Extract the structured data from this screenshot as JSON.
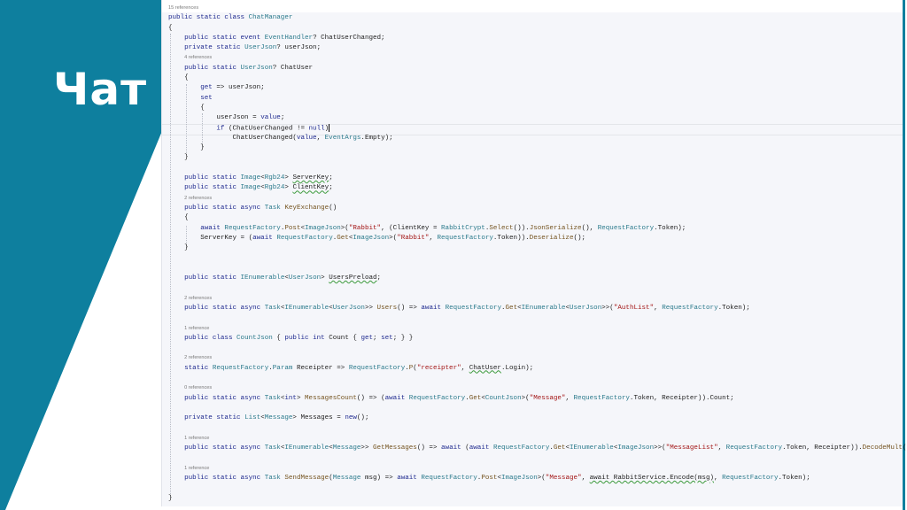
{
  "slide": {
    "title": "Чат",
    "accent": "#0e7f9e"
  },
  "code": {
    "lines": [
      {
        "i": 0,
        "r": "15 references"
      },
      {
        "i": 0,
        "t": [
          [
            "public static class ",
            "k"
          ],
          [
            "ChatManager",
            "t"
          ]
        ]
      },
      {
        "i": 0,
        "t": [
          [
            "{",
            "p"
          ]
        ]
      },
      {
        "i": 4,
        "t": [
          [
            "public static event ",
            "k"
          ],
          [
            "EventHandler",
            "t"
          ],
          [
            "? ChatUserChanged;",
            "p"
          ]
        ]
      },
      {
        "i": 4,
        "t": [
          [
            "private static ",
            "k"
          ],
          [
            "UserJson",
            "t"
          ],
          [
            "? userJson;",
            "p"
          ]
        ]
      },
      {
        "i": 4,
        "r": "4 references"
      },
      {
        "i": 4,
        "t": [
          [
            "public static ",
            "k"
          ],
          [
            "UserJson",
            "t"
          ],
          [
            "? ChatUser",
            "p"
          ]
        ]
      },
      {
        "i": 4,
        "t": [
          [
            "{",
            "p"
          ]
        ]
      },
      {
        "i": 8,
        "t": [
          [
            "get",
            "k"
          ],
          [
            " => userJson;",
            "p"
          ]
        ]
      },
      {
        "i": 8,
        "t": [
          [
            "set",
            "k"
          ]
        ]
      },
      {
        "i": 8,
        "t": [
          [
            "{",
            "p"
          ]
        ]
      },
      {
        "i": 12,
        "t": [
          [
            "userJson = ",
            "p"
          ],
          [
            "value",
            "k"
          ],
          [
            ";",
            "p"
          ]
        ]
      },
      {
        "i": 12,
        "t": [
          [
            "if",
            "k"
          ],
          [
            " (ChatUserChanged != ",
            "p"
          ],
          [
            "null",
            "k"
          ],
          [
            ")",
            "p"
          ]
        ],
        "caret": true
      },
      {
        "i": 16,
        "t": [
          [
            "ChatUserChanged(",
            "p"
          ],
          [
            "value",
            "k"
          ],
          [
            ", ",
            "p"
          ],
          [
            "EventArgs",
            "t"
          ],
          [
            ".Empty);",
            "p"
          ]
        ]
      },
      {
        "i": 8,
        "t": [
          [
            "}",
            "p"
          ]
        ]
      },
      {
        "i": 4,
        "t": [
          [
            "}",
            "p"
          ]
        ]
      },
      {
        "i": 0
      },
      {
        "i": 4,
        "t": [
          [
            "public static ",
            "k"
          ],
          [
            "Image",
            "t"
          ],
          [
            "<",
            "p"
          ],
          [
            "Rgb24",
            "t"
          ],
          [
            "> ",
            "p"
          ],
          [
            "ServerKey",
            "w"
          ],
          [
            ";",
            "p"
          ]
        ]
      },
      {
        "i": 4,
        "t": [
          [
            "public static ",
            "k"
          ],
          [
            "Image",
            "t"
          ],
          [
            "<",
            "p"
          ],
          [
            "Rgb24",
            "t"
          ],
          [
            "> ",
            "p"
          ],
          [
            "ClientKey",
            "w"
          ],
          [
            ";",
            "p"
          ]
        ]
      },
      {
        "i": 4,
        "r": "2 references"
      },
      {
        "i": 4,
        "t": [
          [
            "public static async ",
            "k"
          ],
          [
            "Task",
            "t"
          ],
          [
            " ",
            "p"
          ],
          [
            "KeyExchange",
            "m"
          ],
          [
            "()",
            "p"
          ]
        ]
      },
      {
        "i": 4,
        "t": [
          [
            "{",
            "p"
          ]
        ]
      },
      {
        "i": 8,
        "t": [
          [
            "await ",
            "k"
          ],
          [
            "RequestFactory",
            "t"
          ],
          [
            ".",
            "p"
          ],
          [
            "Post",
            "m"
          ],
          [
            "<",
            "p"
          ],
          [
            "ImageJson",
            "t"
          ],
          [
            ">(",
            "p"
          ],
          [
            "\"Rabbit\"",
            "s"
          ],
          [
            ", (ClientKey = ",
            "p"
          ],
          [
            "RabbitCrypt",
            "t"
          ],
          [
            ".",
            "p"
          ],
          [
            "Select",
            "m"
          ],
          [
            "()).",
            "p"
          ],
          [
            "JsonSerialize",
            "m"
          ],
          [
            "(), ",
            "p"
          ],
          [
            "RequestFactory",
            "t"
          ],
          [
            ".Token);",
            "p"
          ]
        ]
      },
      {
        "i": 8,
        "t": [
          [
            "ServerKey = (",
            "p"
          ],
          [
            "await ",
            "k"
          ],
          [
            "RequestFactory",
            "t"
          ],
          [
            ".",
            "p"
          ],
          [
            "Get",
            "m"
          ],
          [
            "<",
            "p"
          ],
          [
            "ImageJson",
            "t"
          ],
          [
            ">(",
            "p"
          ],
          [
            "\"Rabbit\"",
            "s"
          ],
          [
            ", ",
            "p"
          ],
          [
            "RequestFactory",
            "t"
          ],
          [
            ".Token)).",
            "p"
          ],
          [
            "Deserialize",
            "m"
          ],
          [
            "();",
            "p"
          ]
        ]
      },
      {
        "i": 4,
        "t": [
          [
            "}",
            "p"
          ]
        ]
      },
      {
        "i": 0
      },
      {
        "i": 0
      },
      {
        "i": 4,
        "t": [
          [
            "public static ",
            "k"
          ],
          [
            "IEnumerable",
            "t"
          ],
          [
            "<",
            "p"
          ],
          [
            "UserJson",
            "t"
          ],
          [
            "> ",
            "p"
          ],
          [
            "UsersPreload",
            "w"
          ],
          [
            ";",
            "p"
          ]
        ]
      },
      {
        "i": 0
      },
      {
        "i": 4,
        "r": "2 references"
      },
      {
        "i": 4,
        "t": [
          [
            "public static async ",
            "k"
          ],
          [
            "Task",
            "t"
          ],
          [
            "<",
            "p"
          ],
          [
            "IEnumerable",
            "t"
          ],
          [
            "<",
            "p"
          ],
          [
            "UserJson",
            "t"
          ],
          [
            ">> ",
            "p"
          ],
          [
            "Users",
            "m"
          ],
          [
            "() => ",
            "p"
          ],
          [
            "await ",
            "k"
          ],
          [
            "RequestFactory",
            "t"
          ],
          [
            ".",
            "p"
          ],
          [
            "Get",
            "m"
          ],
          [
            "<",
            "p"
          ],
          [
            "IEnumerable",
            "t"
          ],
          [
            "<",
            "p"
          ],
          [
            "UserJson",
            "t"
          ],
          [
            ">>(",
            "p"
          ],
          [
            "\"AuthList\"",
            "s"
          ],
          [
            ", ",
            "p"
          ],
          [
            "RequestFactory",
            "t"
          ],
          [
            ".Token);",
            "p"
          ]
        ]
      },
      {
        "i": 0
      },
      {
        "i": 4,
        "r": "1 reference"
      },
      {
        "i": 4,
        "t": [
          [
            "public class ",
            "k"
          ],
          [
            "CountJson",
            "t"
          ],
          [
            " { ",
            "p"
          ],
          [
            "public int ",
            "k"
          ],
          [
            "Count { ",
            "p"
          ],
          [
            "get",
            "k"
          ],
          [
            "; ",
            "p"
          ],
          [
            "set",
            "k"
          ],
          [
            "; } }",
            "p"
          ]
        ]
      },
      {
        "i": 0
      },
      {
        "i": 4,
        "r": "2 references"
      },
      {
        "i": 4,
        "t": [
          [
            "static ",
            "k"
          ],
          [
            "RequestFactory",
            "t"
          ],
          [
            ".",
            "p"
          ],
          [
            "Param",
            "t"
          ],
          [
            " Receipter => ",
            "p"
          ],
          [
            "RequestFactory",
            "t"
          ],
          [
            ".",
            "p"
          ],
          [
            "P",
            "m"
          ],
          [
            "(",
            "p"
          ],
          [
            "\"receipter\"",
            "s"
          ],
          [
            ", ",
            "p"
          ],
          [
            "ChatUser",
            "w"
          ],
          [
            ".Login);",
            "p"
          ]
        ]
      },
      {
        "i": 0
      },
      {
        "i": 4,
        "r": "0 references"
      },
      {
        "i": 4,
        "t": [
          [
            "public static async ",
            "k"
          ],
          [
            "Task",
            "t"
          ],
          [
            "<",
            "p"
          ],
          [
            "int",
            "k"
          ],
          [
            "> ",
            "p"
          ],
          [
            "MessagesCount",
            "m"
          ],
          [
            "() => (",
            "p"
          ],
          [
            "await ",
            "k"
          ],
          [
            "RequestFactory",
            "t"
          ],
          [
            ".",
            "p"
          ],
          [
            "Get",
            "m"
          ],
          [
            "<",
            "p"
          ],
          [
            "CountJson",
            "t"
          ],
          [
            ">(",
            "p"
          ],
          [
            "\"Message\"",
            "s"
          ],
          [
            ", ",
            "p"
          ],
          [
            "RequestFactory",
            "t"
          ],
          [
            ".Token, Receipter)).Count;",
            "p"
          ]
        ]
      },
      {
        "i": 0
      },
      {
        "i": 4,
        "t": [
          [
            "private static ",
            "k"
          ],
          [
            "List",
            "t"
          ],
          [
            "<",
            "p"
          ],
          [
            "Message",
            "t"
          ],
          [
            "> Messages = ",
            "p"
          ],
          [
            "new",
            "k"
          ],
          [
            "();",
            "p"
          ]
        ]
      },
      {
        "i": 0
      },
      {
        "i": 4,
        "r": "1 reference"
      },
      {
        "i": 4,
        "t": [
          [
            "public static async ",
            "k"
          ],
          [
            "Task",
            "t"
          ],
          [
            "<",
            "p"
          ],
          [
            "IEnumerable",
            "t"
          ],
          [
            "<",
            "p"
          ],
          [
            "Message",
            "t"
          ],
          [
            ">> ",
            "p"
          ],
          [
            "GetMessages",
            "m"
          ],
          [
            "() => ",
            "p"
          ],
          [
            "await ",
            "k"
          ],
          [
            "(",
            "p"
          ],
          [
            "await ",
            "k"
          ],
          [
            "RequestFactory",
            "t"
          ],
          [
            ".",
            "p"
          ],
          [
            "Get",
            "m"
          ],
          [
            "<",
            "p"
          ],
          [
            "IEnumerable",
            "t"
          ],
          [
            "<",
            "p"
          ],
          [
            "ImageJson",
            "t"
          ],
          [
            ">>(",
            "p"
          ],
          [
            "\"MessageList\"",
            "s"
          ],
          [
            ", ",
            "p"
          ],
          [
            "RequestFactory",
            "t"
          ],
          [
            ".Token, Receipter)).",
            "p"
          ],
          [
            "DecodeMult",
            "m"
          ],
          [
            "();",
            "p"
          ]
        ]
      },
      {
        "i": 0
      },
      {
        "i": 4,
        "r": "1 reference"
      },
      {
        "i": 4,
        "t": [
          [
            "public static async ",
            "k"
          ],
          [
            "Task",
            "t"
          ],
          [
            " ",
            "p"
          ],
          [
            "SendMessage",
            "m"
          ],
          [
            "(",
            "p"
          ],
          [
            "Message",
            "t"
          ],
          [
            " msg) => ",
            "p"
          ],
          [
            "await ",
            "k"
          ],
          [
            "RequestFactory",
            "t"
          ],
          [
            ".",
            "p"
          ],
          [
            "Post",
            "m"
          ],
          [
            "<",
            "p"
          ],
          [
            "ImageJson",
            "t"
          ],
          [
            ">(",
            "p"
          ],
          [
            "\"Message\"",
            "s"
          ],
          [
            ", ",
            "p"
          ],
          [
            "await RabbitService.Encode(msg)",
            "w"
          ],
          [
            ", ",
            "p"
          ],
          [
            "RequestFactory",
            "t"
          ],
          [
            ".Token);",
            "p"
          ]
        ]
      },
      {
        "i": 0
      },
      {
        "i": 0,
        "t": [
          [
            "}",
            "p"
          ]
        ]
      }
    ]
  }
}
